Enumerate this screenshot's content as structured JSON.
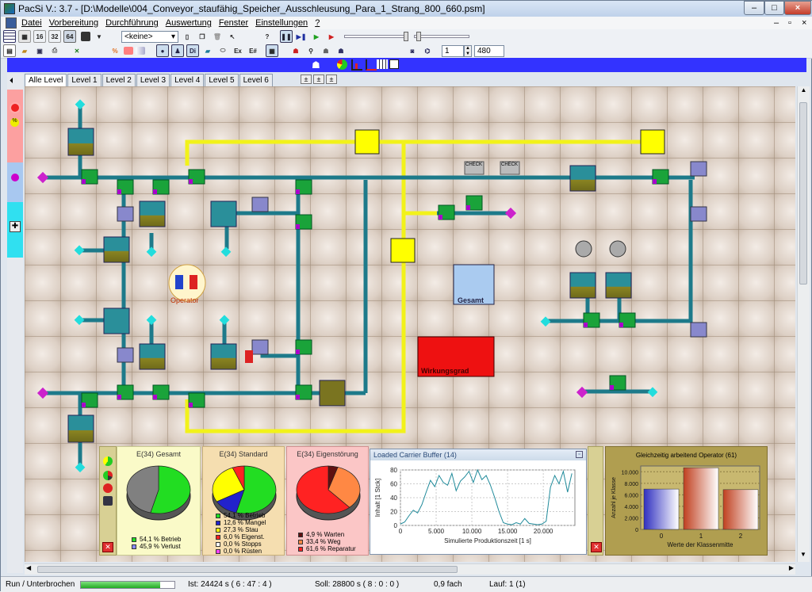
{
  "window": {
    "title": "PacSi V.: 3.7 - [D:\\Modelle\\004_Conveyor_staufähig_Speicher_Ausschleusung_Para_1_Strang_800_660.psm]",
    "controls": [
      "–",
      "□",
      "×"
    ],
    "mdi_controls": [
      "–",
      "▫",
      "×"
    ]
  },
  "menu": [
    "Datei",
    "Vorbereitung",
    "Durchführung",
    "Auswertung",
    "Fenster",
    "Einstellungen",
    "?"
  ],
  "toolbar1": {
    "grid_buttons": [
      "16",
      "32",
      "64"
    ],
    "dropdown_value": "<keine>"
  },
  "toolbar2": {
    "spin_value": "1",
    "end_value": "480"
  },
  "tabs": [
    "Alle Level",
    "Level 1",
    "Level 2",
    "Level 3",
    "Level 4",
    "Level 5",
    "Level 6"
  ],
  "tab_right_buttons": [
    "±",
    "±",
    "±"
  ],
  "model": {
    "operator_label": "Operator",
    "gesamt_label": "Gesamt",
    "wirkungsgrad_label": "Wirkungsgrad",
    "check_labels": [
      "CHECK",
      "CHECK"
    ]
  },
  "charts": {
    "pie1": {
      "title": "E(34) Gesamt",
      "legend": [
        "54,1 % Betrieb",
        "45,9 % Verlust"
      ],
      "colors": [
        "#22dd22",
        "#808080"
      ],
      "chart_data": {
        "type": "pie",
        "categories": [
          "Betrieb",
          "Verlust"
        ],
        "values": [
          54.1,
          45.9
        ]
      }
    },
    "pie2": {
      "title": "E(34) Standard",
      "legend": [
        "54,1 % Betrieb",
        "12,6 % Mangel",
        "27,3 % Stau",
        "6,0 % Eigenst.",
        "0,0 % Stopps",
        "0,0 % Rüsten"
      ],
      "colors": [
        "#22dd22",
        "#2222cc",
        "#ffff00",
        "#ff2222",
        "#ffffff",
        "#ff44ff"
      ],
      "chart_data": {
        "type": "pie",
        "categories": [
          "Betrieb",
          "Mangel",
          "Stau",
          "Eigenst.",
          "Stopps",
          "Rüsten"
        ],
        "values": [
          54.1,
          12.6,
          27.3,
          6.0,
          0.0,
          0.0
        ]
      }
    },
    "pie3": {
      "title": "E(34) Eigenstörung",
      "legend": [
        "4,9 % Warten",
        "33,4 % Weg",
        "61,6 % Reparatur"
      ],
      "colors": [
        "#601010",
        "#ff8844",
        "#ff2222"
      ],
      "chart_data": {
        "type": "pie",
        "categories": [
          "Warten",
          "Weg",
          "Reparatur"
        ],
        "values": [
          4.9,
          33.4,
          61.6
        ]
      }
    },
    "line": {
      "window_title": "Loaded Carrier Buffer (14)",
      "chart_data": {
        "type": "line",
        "xlabel": "Simulierte Produktionszeit [1 s]",
        "ylabel": "Inhalt [1 Stck]",
        "xlim": [
          0,
          24424
        ],
        "ylim": [
          0,
          80
        ],
        "xticks": [
          "0",
          "5.000",
          "10.000",
          "15.000",
          "20.000"
        ],
        "yticks": [
          "0",
          "20",
          "40",
          "60",
          "80"
        ],
        "x": [
          0,
          600,
          1200,
          1800,
          2400,
          3000,
          3600,
          4200,
          4800,
          5400,
          6000,
          6600,
          7200,
          7800,
          8400,
          9000,
          9600,
          10200,
          10800,
          11400,
          12000,
          12600,
          13200,
          13800,
          14400,
          15000,
          15600,
          16200,
          16800,
          17400,
          18000,
          18600,
          19200,
          19800,
          20400,
          21000,
          21600,
          22200,
          22800,
          23400,
          24000
        ],
        "y": [
          2,
          5,
          14,
          22,
          18,
          30,
          48,
          65,
          56,
          72,
          62,
          58,
          75,
          50,
          64,
          70,
          78,
          62,
          80,
          66,
          72,
          58,
          40,
          20,
          4,
          2,
          1,
          4,
          2,
          10,
          3,
          2,
          1,
          2,
          6,
          55,
          72,
          60,
          78,
          48,
          75
        ]
      }
    },
    "bar": {
      "title": "Gleichzeitig arbeitend Operator (61)",
      "chart_data": {
        "type": "bar",
        "categories": [
          "0",
          "1",
          "2"
        ],
        "values": [
          7000,
          10700,
          6900
        ],
        "xlabel": "Werte der Klassenmitte",
        "ylabel": "Anzahl je Klasse",
        "ylim": [
          0,
          11000
        ],
        "yticks": [
          "0",
          "2.000",
          "4.000",
          "6.000",
          "8.000",
          "10.000"
        ]
      }
    }
  },
  "status": {
    "state": "Run / Unterbrochen",
    "progress": 0.85,
    "ist": "Ist: 24424  s  ( 6 : 47 : 4 )",
    "soll": "Soll: 28800  s  ( 8 : 0 : 0 )",
    "speed": "0,9 fach",
    "lauf": "Lauf: 1 (1)"
  }
}
